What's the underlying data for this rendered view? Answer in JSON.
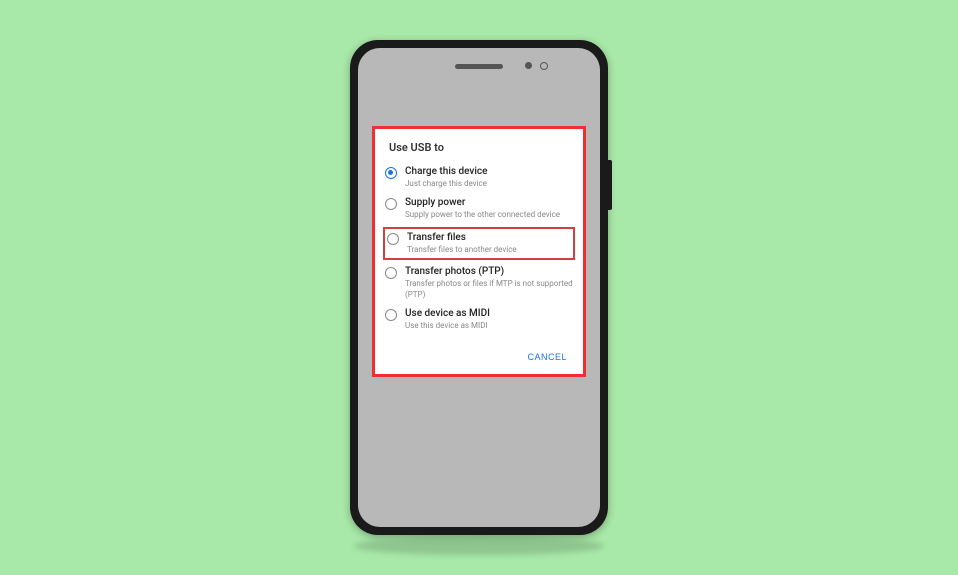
{
  "dialog": {
    "title": "Use USB to",
    "options": [
      {
        "label": "Charge this device",
        "desc": "Just charge this device",
        "selected": true
      },
      {
        "label": "Supply power",
        "desc": "Supply power to the other connected device",
        "selected": false
      },
      {
        "label": "Transfer files",
        "desc": "Transfer files to another device",
        "selected": false,
        "highlighted": true
      },
      {
        "label": "Transfer photos (PTP)",
        "desc": "Transfer photos or files if MTP is not supported (PTP)",
        "selected": false
      },
      {
        "label": "Use device as MIDI",
        "desc": "Use this device as MIDI",
        "selected": false
      }
    ],
    "cancel": "CANCEL"
  }
}
